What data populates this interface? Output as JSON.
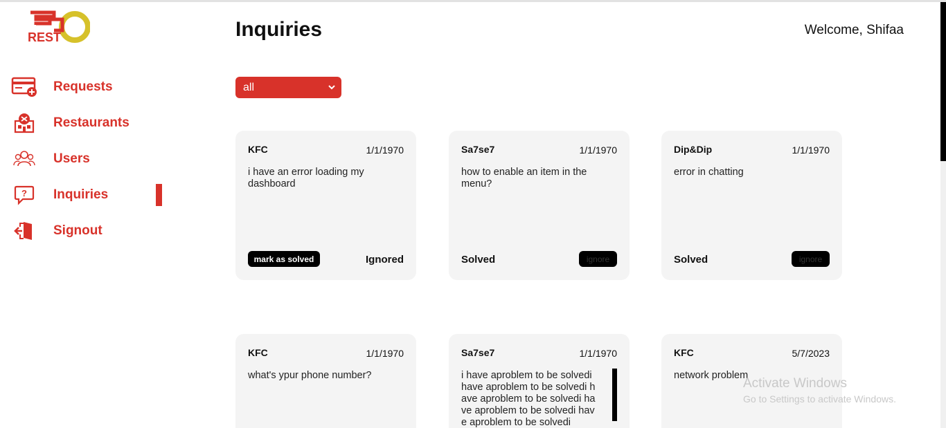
{
  "app": {
    "logo_text_top": "GO",
    "logo_text_bottom": "REST",
    "brand_color": "#d8322a",
    "logo_accent": "#d6c12a"
  },
  "sidebar": {
    "items": [
      {
        "label": "Requests",
        "icon": "card-add-icon",
        "active": false
      },
      {
        "label": "Restaurants",
        "icon": "restaurant-icon",
        "active": false
      },
      {
        "label": "Users",
        "icon": "users-icon",
        "active": false
      },
      {
        "label": "Inquiries",
        "icon": "question-bubble-icon",
        "active": true
      },
      {
        "label": "Signout",
        "icon": "signout-icon",
        "active": false
      }
    ]
  },
  "header": {
    "title": "Inquiries",
    "welcome": "Welcome, Shifaa"
  },
  "filter": {
    "selected": "all"
  },
  "cards": [
    {
      "name": "KFC",
      "date": "1/1/1970",
      "message": "i have an error loading my dashboard",
      "action": "mark as solved",
      "status": "Ignored"
    },
    {
      "name": "Sa7se7",
      "date": "1/1/1970",
      "message": "how to enable an item in the menu?",
      "status": "Solved",
      "action": "ignore"
    },
    {
      "name": "Dip&Dip",
      "date": "1/1/1970",
      "message": "error in chatting",
      "status": "Solved",
      "action": "ignore"
    },
    {
      "name": "KFC",
      "date": "1/1/1970",
      "message": "what's ypur phone number?"
    },
    {
      "name": "Sa7se7",
      "date": "1/1/1970",
      "message": "i have aproblem to be solvedi have aproblem to be solvedi have aproblem to be solvedi have aproblem to be solvedi have aproblem to be solvedi"
    },
    {
      "name": "KFC",
      "date": "5/7/2023",
      "message": "network problem"
    }
  ],
  "watermark": {
    "title": "Activate Windows",
    "subtitle": "Go to Settings to activate Windows."
  }
}
